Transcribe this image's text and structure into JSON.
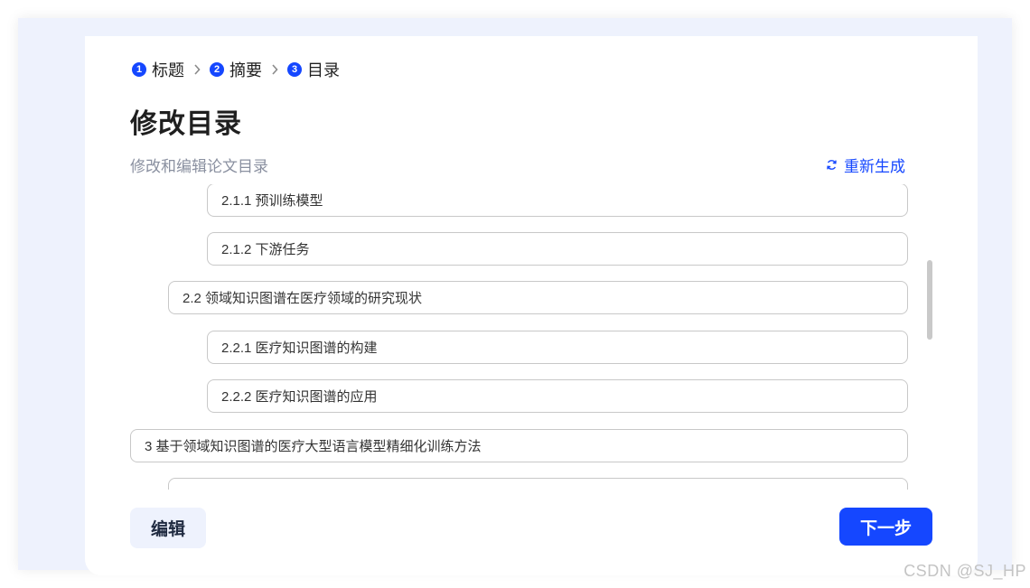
{
  "steps": [
    {
      "num": "1",
      "label": "标题"
    },
    {
      "num": "2",
      "label": "摘要"
    },
    {
      "num": "3",
      "label": "目录"
    }
  ],
  "page": {
    "title": "修改目录",
    "subtitle": "修改和编辑论文目录",
    "regenerate_label": "重新生成"
  },
  "toc": [
    {
      "text": "2.1.1 预训练模型",
      "level": 3
    },
    {
      "text": "2.1.2 下游任务",
      "level": 3
    },
    {
      "text": "2.2 领域知识图谱在医疗领域的研究现状",
      "level": 2
    },
    {
      "text": "2.2.1 医疗知识图谱的构建",
      "level": 3
    },
    {
      "text": "2.2.2 医疗知识图谱的应用",
      "level": 3
    },
    {
      "text": "3 基于领域知识图谱的医疗大型语言模型精细化训练方法",
      "level": 1
    },
    {
      "text": "",
      "level": 2
    }
  ],
  "footer": {
    "edit_label": "编辑",
    "next_label": "下一步"
  },
  "watermark": "CSDN @SJ_HP",
  "colors": {
    "accent": "#1547ff",
    "background": "#eef2fd",
    "border": "#c8c8c8"
  }
}
